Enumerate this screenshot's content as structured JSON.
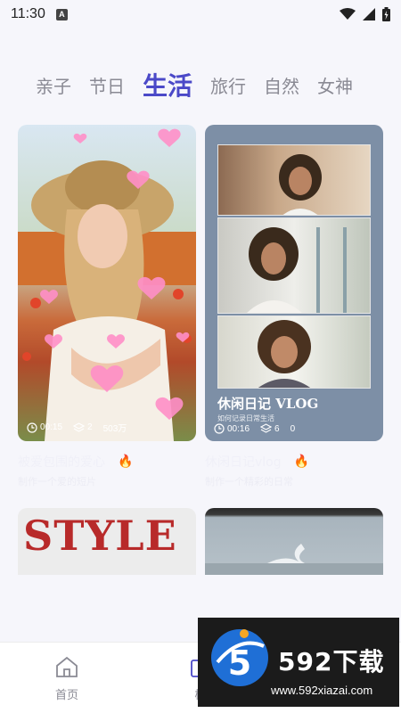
{
  "status_bar": {
    "time": "11:30",
    "a_icon_text": "A",
    "icons": [
      "wifi-icon",
      "signal-icon",
      "battery-icon"
    ]
  },
  "tabs": [
    {
      "label": "亲子",
      "active": false
    },
    {
      "label": "节日",
      "active": false
    },
    {
      "label": "生活",
      "active": true
    },
    {
      "label": "旅行",
      "active": false
    },
    {
      "label": "自然",
      "active": false
    },
    {
      "label": "女神",
      "active": false
    }
  ],
  "cards": [
    {
      "stats": {
        "duration": "00:15",
        "layers": "2",
        "uses": "503万"
      },
      "caption": "被爱包围的爱心",
      "hot_icon": "fire-icon",
      "subcaption": "制作一个爱的短片"
    },
    {
      "overlay_title": "休闲日记 VLOG",
      "overlay_subtitle": "如何记录日常生活",
      "stats": {
        "duration": "00:16",
        "layers": "6",
        "uses": "0"
      },
      "caption": "休闲日记vlog",
      "hot_icon": "fire-icon",
      "subcaption": "制作一个精彩的日常"
    },
    {
      "overlay_text": "STYLE"
    },
    {}
  ],
  "bottom_nav": [
    {
      "label": "首页",
      "icon": "home-icon"
    },
    {
      "label": "模",
      "icon": "template-icon"
    }
  ],
  "watermark": {
    "text": "592下载",
    "url": "www.592xiazai.com",
    "badge": "5"
  },
  "colors": {
    "accent": "#4b49c8",
    "inactive": "#8a8a94",
    "background": "#f6f6fb"
  }
}
